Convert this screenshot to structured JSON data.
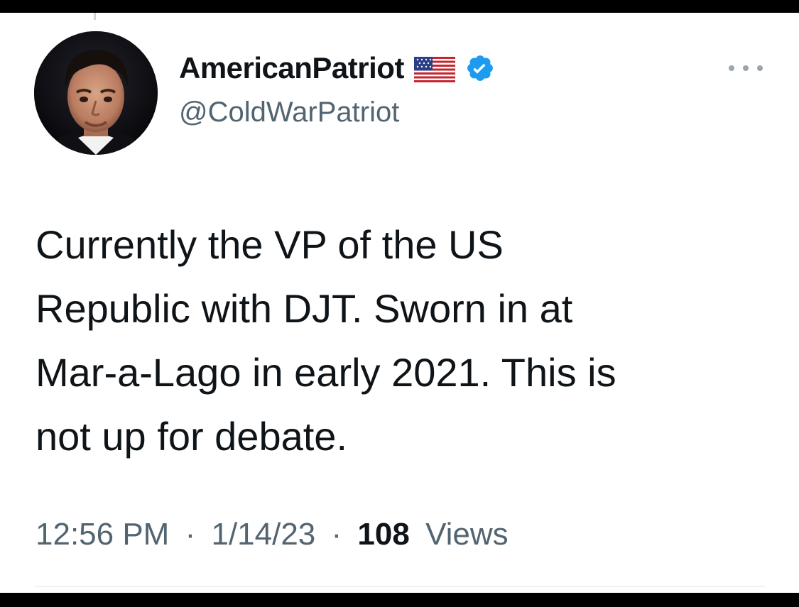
{
  "tweet": {
    "author": {
      "display_name": "AmericanPatriot",
      "handle": "@ColdWarPatriot",
      "name_icons": [
        "us-flag-icon",
        "verified-badge-icon"
      ],
      "verified_color": "#1d9bf0"
    },
    "text": "Currently the VP of the US\nRepublic with DJT. Sworn in at\nMar-a-Lago in early 2021. This is\nnot up for debate.",
    "meta": {
      "time": "12:56 PM",
      "separator": "·",
      "date": "1/14/23",
      "views_count": "108",
      "views_label": "Views"
    },
    "more_icon": "more-horizontal-icon"
  },
  "colors": {
    "text_primary": "#0f1419",
    "text_secondary": "#536471",
    "background": "#ffffff",
    "frame": "#000000"
  }
}
